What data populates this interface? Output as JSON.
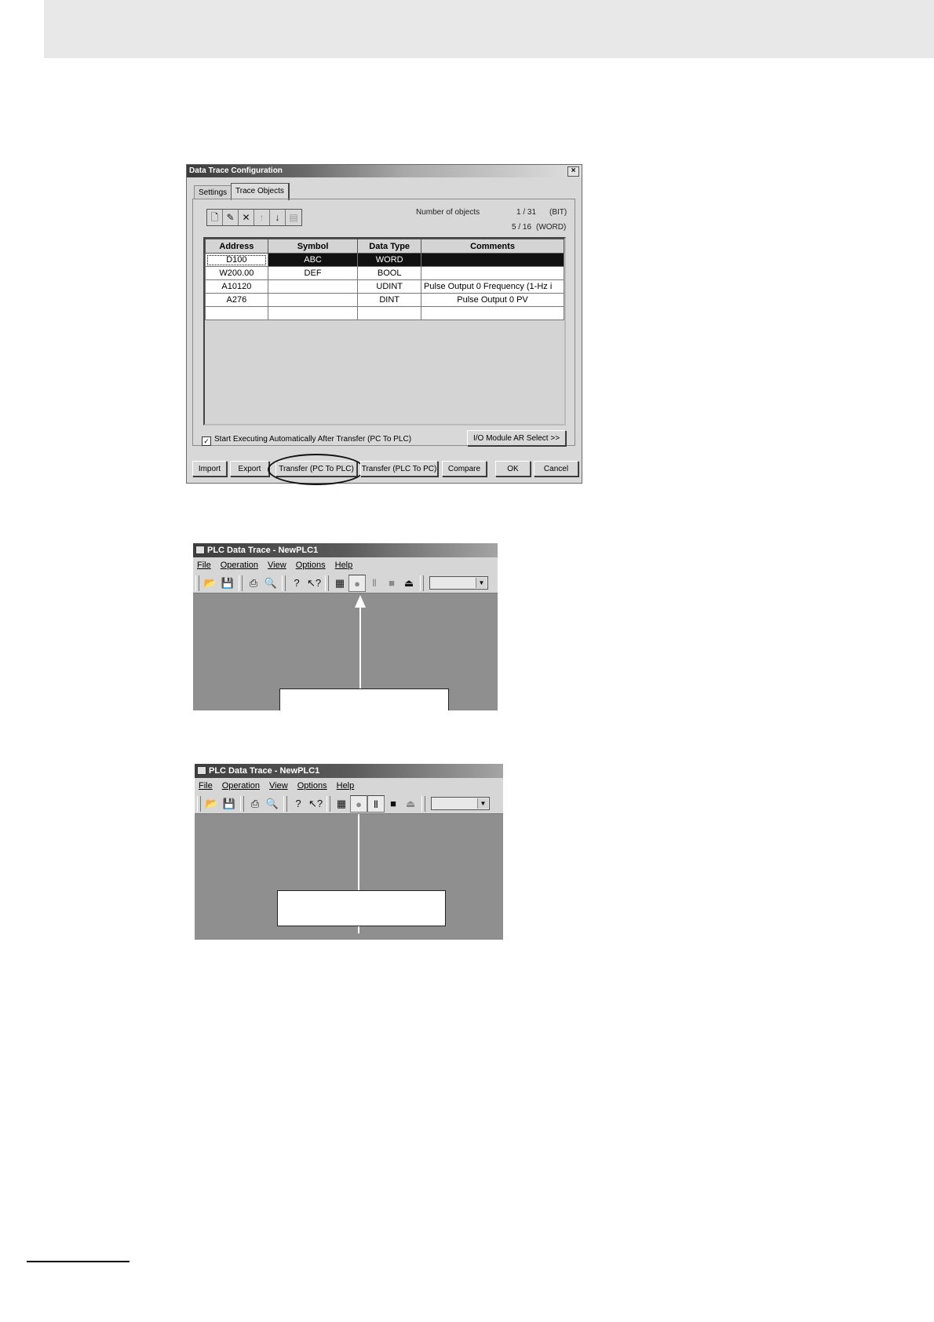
{
  "dialog": {
    "title": "Data Trace Configuration",
    "close_glyph": "×",
    "tabs": [
      {
        "label": "Settings",
        "active": false
      },
      {
        "label": "Trace Objects",
        "active": true
      }
    ],
    "toolbar_icons": [
      "new-icon",
      "edit-icon",
      "delete-icon",
      "move-up-icon",
      "move-down-icon",
      "paste-icon"
    ],
    "count_label": "Number of objects",
    "count_bit": "1 / 31",
    "count_bit_unit": "(BIT)",
    "count_word": "5 / 16",
    "count_word_unit": "(WORD)",
    "table": {
      "headers": [
        "Address",
        "Symbol",
        "Data Type",
        "Comments"
      ],
      "rows": [
        {
          "address": "D100",
          "symbol": "ABC",
          "type": "WORD",
          "comment": ""
        },
        {
          "address": "W200.00",
          "symbol": "DEF",
          "type": "BOOL",
          "comment": ""
        },
        {
          "address": "A10120",
          "symbol": "",
          "type": "UDINT",
          "comment": "Pulse Output 0 Frequency (1-Hz i"
        },
        {
          "address": "A276",
          "symbol": "",
          "type": "DINT",
          "comment": "Pulse Output 0 PV"
        },
        {
          "address": "",
          "symbol": "",
          "type": "",
          "comment": ""
        }
      ]
    },
    "checkbox_mark": "✓",
    "checkbox_label": "Start Executing Automatically After Transfer (PC To PLC)",
    "io_button": "I/O Module AR Select >>",
    "buttons": {
      "import": "Import",
      "export": "Export",
      "transfer_pc_to_plc": "Transfer (PC To PLC)",
      "transfer_plc_to_pc": "Transfer (PLC To PC)",
      "compare": "Compare",
      "ok": "OK",
      "cancel": "Cancel"
    }
  },
  "app_window_1": {
    "title": "PLC Data Trace - NewPLC1",
    "menu": [
      "File",
      "Operation",
      "View",
      "Options",
      "Help"
    ]
  },
  "app_window_2": {
    "title": "PLC Data Trace - NewPLC1",
    "menu": [
      "File",
      "Operation",
      "View",
      "Options",
      "Help"
    ]
  },
  "toolbar_glyphs": {
    "open": "📂",
    "save": "💾",
    "print": "⎙",
    "preview": "🔍",
    "help": "?",
    "context_help": "↖?",
    "settings": "▦",
    "start": "●",
    "pause": "Ⅱ",
    "stop": "■",
    "eject": "⏏",
    "combo_arrow": "▼"
  }
}
